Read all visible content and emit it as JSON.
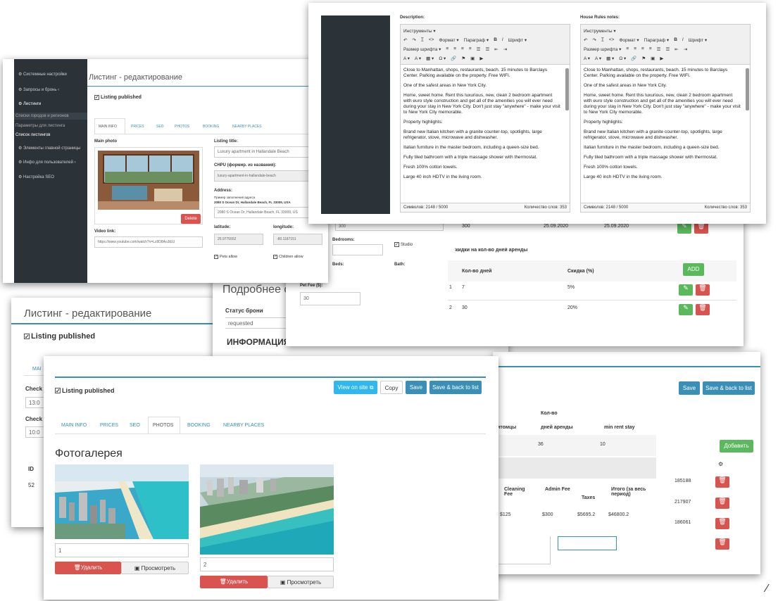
{
  "c1": {
    "title": "Листинг - редактирование",
    "published": "Listing published",
    "sidebar": [
      "Системные настройки",
      "Запросы и бронь",
      "Листинги",
      "Списки городов и регионов",
      "Параметры для листинга",
      "Список листингов",
      "Элементы главной страницы",
      "Инфо для пользователей",
      "Настройка SEO"
    ],
    "tabs": [
      "MAIN INFO",
      "PRICES",
      "SEO",
      "PHOTOS",
      "BOOKING",
      "NEARBY PLACES"
    ],
    "main_photo": "Main photo",
    "delete": "Delete",
    "video_label": "Video link:",
    "video": "https://www.youtube.com/watch?v=Lz9D8AoJiEU",
    "title_label": "Listing title:",
    "title_val": "Luxury apartment in Hallandale Beach",
    "chpu_label": "CHPU (формир. из названия):",
    "chpu_val": "luxury-apartment-in-hallandale-beach",
    "address_label": "Address:",
    "addr_hint": "Пример заполнения адреса",
    "addr_example": "2080 S Ocean Dr, Hallandale Beach, FL 33009, USA",
    "addr_val": "2080 S Ocean Dr, Hallandale Beach, FL 33009, US",
    "lat_label": "latitude:",
    "lat": "25.9775552",
    "lon_label": "longitude:",
    "lon": "-80.1187151",
    "pets": "Pets allow",
    "children": "Children allow"
  },
  "c2": {
    "desc_label": "Description:",
    "rules_label": "House Rules notes:",
    "tools": "Инструменты",
    "format": "Формат",
    "para": "Параграф",
    "font": "Шрифт",
    "size": "Размер шрифта",
    "paras": [
      "Close to Manhattan, shops, restaurants, beach. 15 minutes to Barclays Center. Parking available on the property. Free WIFI.",
      "One of the safest areas in New York City.",
      "Home, sweet home. Rent this luxurious, new, clean 2 bedroom apartment with euro style construction and get all of the amenities you will ever need during your stay in New York City. Don't just stay \"anywhere\" - make your visit to New York City memorable.",
      "Property highlights:",
      "Brand new Italian kitchen with a granite counter-top, spotlights, large refrigerator, stove, microwave and dishwasher.",
      "Italian furniture in the master bedroom, including a queen-size bed.",
      "Fully tiled bathroom with a triple massage shower with thermostat.",
      "Fresh 100% cotton towels.",
      "Large 40 inch HDTV in the living room."
    ],
    "chars": "Символов: 2148 / 5000",
    "words": "Количество слов: 353"
  },
  "c3": {
    "dates": [
      "300",
      "25.09.2020",
      "25.09.2020"
    ],
    "bedrooms": "Bedrooms:",
    "studio": "Studio",
    "beds": "Beds:",
    "bath": "Bath:",
    "pet_fee": "Pet Fee ($):",
    "pet_val": "30",
    "discount_title": "Скидки на кол-во дней аренды",
    "col_days": "Кол-во дней",
    "col_disc": "Скидка (%)",
    "add": "ADD",
    "rows": [
      [
        "1",
        "7",
        "5%"
      ],
      [
        "2",
        "30",
        "20%"
      ]
    ]
  },
  "c4": {
    "title": "Листинг - редактирование",
    "published": "Listing published",
    "tab": "MAI",
    "check_in": "Check",
    "ci_val": "13:0",
    "check_out": "Check",
    "co_val": "10:0",
    "id": "ID",
    "id_val": "52"
  },
  "c5": {
    "heading": "Подробнее о бр",
    "status_label": "Статус брони",
    "status_val": "requested",
    "info": "ИНФОРМАЦИЯ"
  },
  "c6": {
    "save": "Save",
    "save_back": "Save & back to list",
    "kolvo": "Кол-во",
    "c_pets": "итомцы",
    "c_days": "дней аренды",
    "c_min": "min rent stay",
    "v_days": "36",
    "v_min": "10",
    "fee_h": [
      "Cleaning Fee",
      "Admin Fee",
      "Taxes",
      "Итого (за весь период)"
    ],
    "fee_v": [
      "$125",
      "$300",
      "$5695.2",
      "$46800.2"
    ],
    "add": "Добавить",
    "ids": [
      "185188",
      "217907",
      "186061"
    ]
  },
  "c7": {
    "published": "Listing published",
    "view": "View on site",
    "copy": "Copy",
    "save": "Save",
    "save_back": "Save & back to list",
    "tabs": [
      "MAIN INFO",
      "PRICES",
      "SEO",
      "PHOTOS",
      "BOOKING",
      "NEARBY PLACES"
    ],
    "gallery": "Фотогалерея",
    "p1": "1",
    "p2": "2",
    "del": "Удалить",
    "view_btn": "Просмотреть"
  },
  "colors": {
    "blue": "#3a8fb7",
    "red": "#d9534f",
    "green": "#5cb85c",
    "sidebar": "#2c3338",
    "cyan": "#2fb8f0"
  }
}
